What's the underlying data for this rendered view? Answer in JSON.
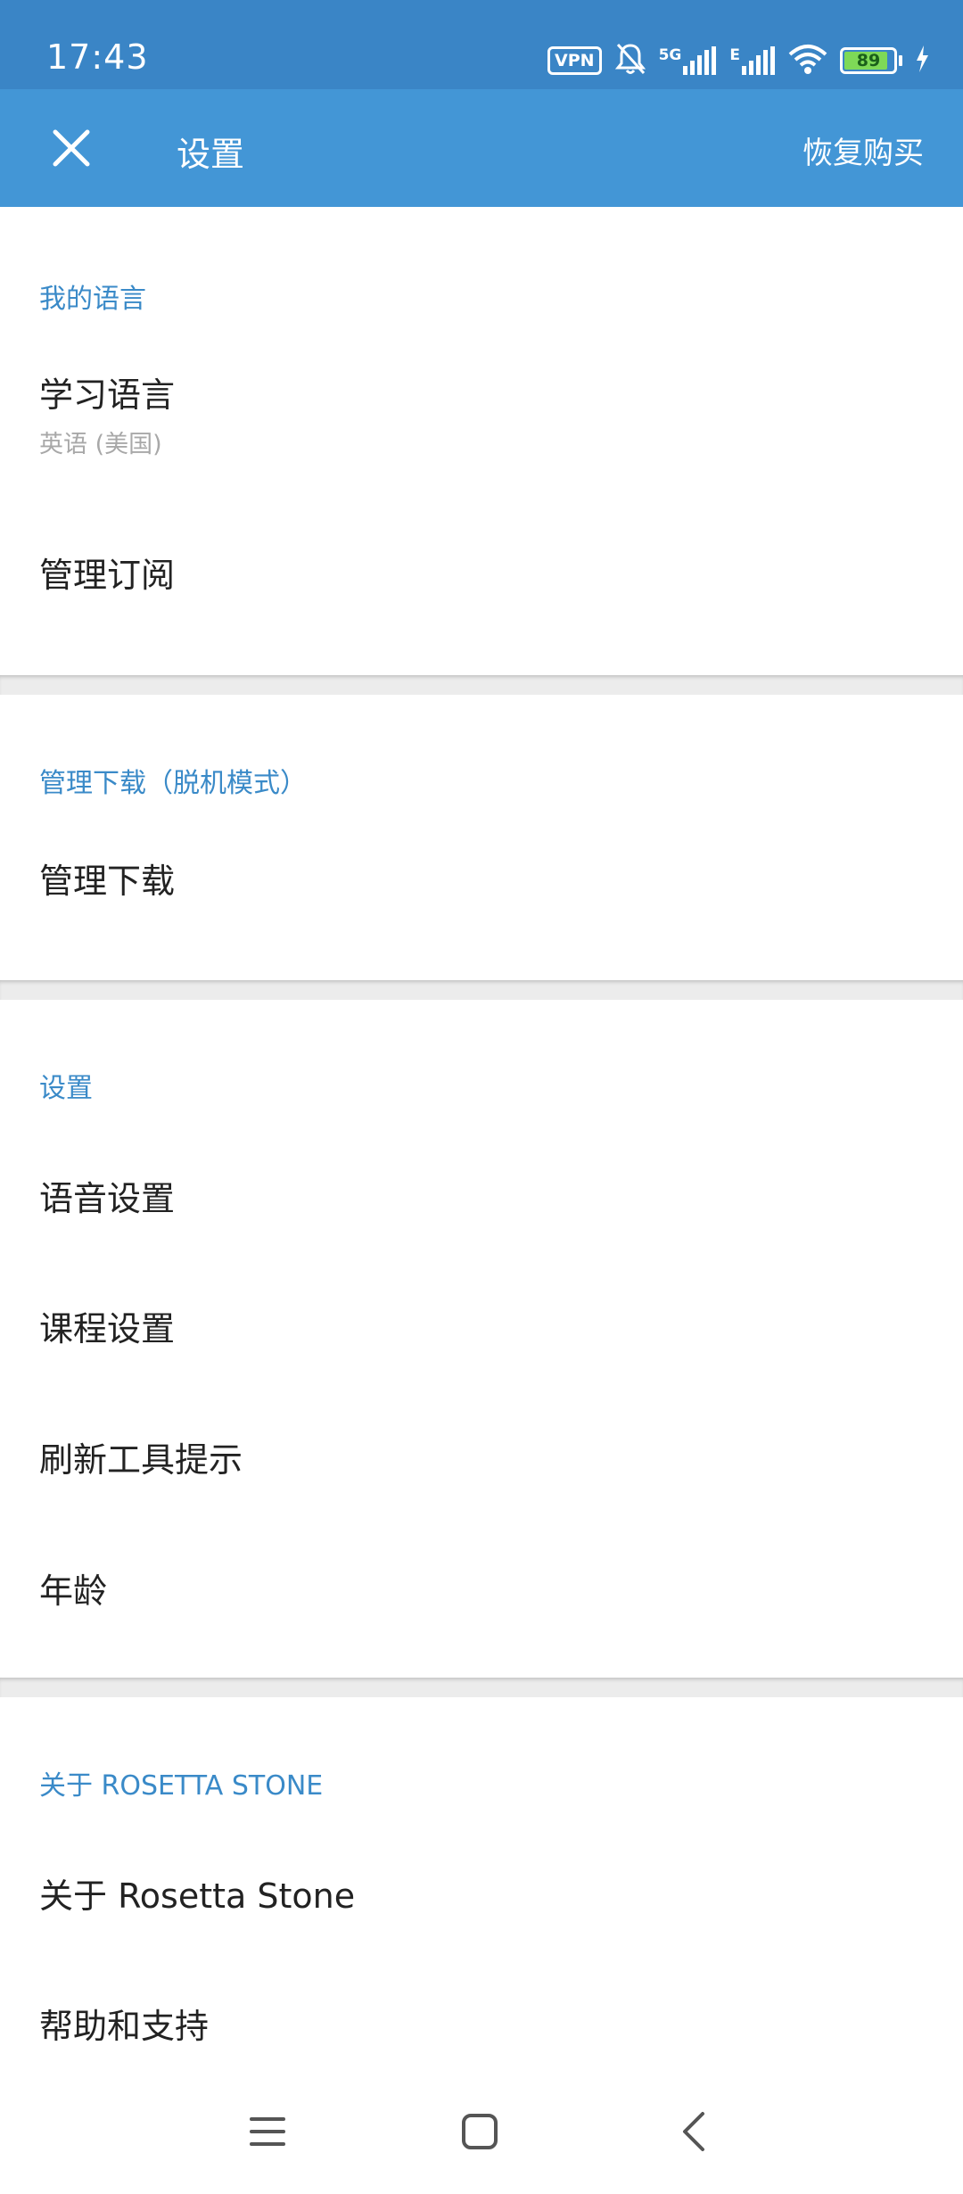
{
  "status_bar": {
    "time": "17:43",
    "vpn": "VPN",
    "signal_label_1": "5G",
    "signal_label_2": "E",
    "battery": "89"
  },
  "app_bar": {
    "title": "设置",
    "restore_label": "恢复购买"
  },
  "sections": {
    "my_language": {
      "header": "我的语言",
      "study_language": "学习语言",
      "study_language_value": "英语 (美国)",
      "manage_subscription": "管理订阅"
    },
    "downloads": {
      "header": "管理下载（脱机模式）",
      "manage_downloads": "管理下载"
    },
    "settings": {
      "header": "设置",
      "voice_settings": "语音设置",
      "course_settings": "课程设置",
      "refresh_tooltips": "刷新工具提示",
      "age": "年龄"
    },
    "about": {
      "header": "关于 ROSETTA STONE",
      "about_rosetta": "关于 Rosetta Stone",
      "help_support": "帮助和支持"
    }
  },
  "colors": {
    "status_bar": "#3a85c6",
    "app_bar": "#4396d6",
    "section_header": "#3a8ac8"
  },
  "icons": {
    "close": "close-icon",
    "menu": "menu-icon",
    "home": "home-icon",
    "back": "back-icon"
  }
}
